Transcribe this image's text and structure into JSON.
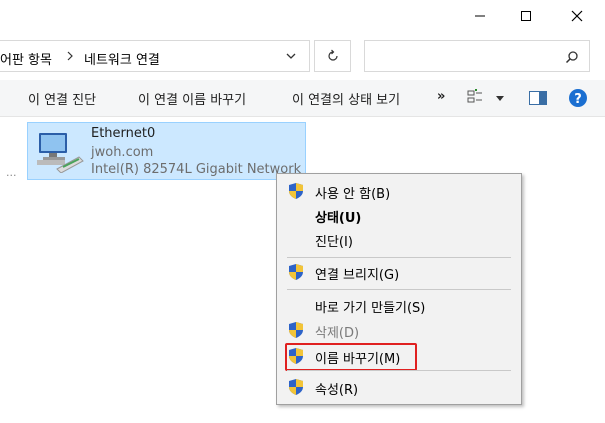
{
  "address": {
    "crumb_parent": "어판 항목",
    "crumb_current": "네트워크 연결"
  },
  "toolbar": {
    "diagnose": "이 연결 진단",
    "rename": "이 연결 이름 바꾸기",
    "status": "이 연결의 상태 보기",
    "more": "»"
  },
  "connection": {
    "name": "Ethernet0",
    "network": "jwoh.com",
    "device": "Intel(R) 82574L Gigabit Network"
  },
  "left_truncation": "...",
  "context_menu": {
    "items": [
      {
        "label": "사용 안 함(B)"
      },
      {
        "label": "상태(U)"
      },
      {
        "label": "진단(I)"
      },
      {
        "label": "연결 브리지(G)"
      },
      {
        "label": "바로 가기 만들기(S)"
      },
      {
        "label": "삭제(D)"
      },
      {
        "label": "이름 바꾸기(M)"
      },
      {
        "label": "속성(R)"
      }
    ]
  },
  "colors": {
    "selection_bg": "#cce8ff",
    "selection_border": "#99d1ff",
    "highlight_box": "#e02020",
    "help_blue": "#1b6fd1"
  }
}
